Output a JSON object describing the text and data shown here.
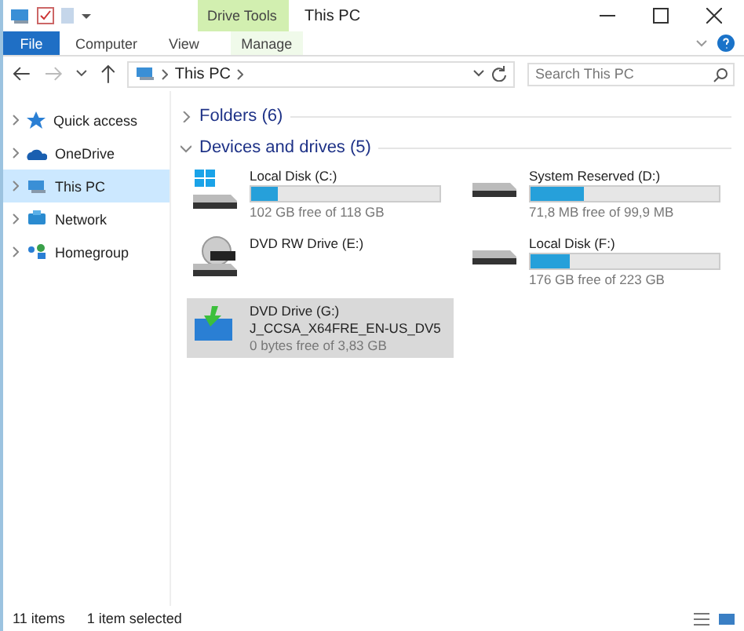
{
  "window": {
    "title": "This PC",
    "context_tab": "Drive Tools"
  },
  "ribbon_tabs": [
    {
      "label": "File",
      "kind": "file"
    },
    {
      "label": "Computer",
      "kind": "plain"
    },
    {
      "label": "View",
      "kind": "plain"
    },
    {
      "label": "Manage",
      "kind": "context"
    }
  ],
  "address": {
    "path": "This PC",
    "search_placeholder": "Search This PC"
  },
  "sidebar": {
    "items": [
      {
        "label": "Quick access",
        "kind": "star",
        "selected": false
      },
      {
        "label": "OneDrive",
        "kind": "cloud",
        "selected": false
      },
      {
        "label": "This PC",
        "kind": "pc",
        "selected": true
      },
      {
        "label": "Network",
        "kind": "network",
        "selected": false
      },
      {
        "label": "Homegroup",
        "kind": "homegroup",
        "selected": false
      }
    ]
  },
  "sections": [
    {
      "title": "Folders (6)",
      "expanded": false
    },
    {
      "title": "Devices and drives (5)",
      "expanded": true
    }
  ],
  "drives": [
    {
      "name": "Local Disk (C:)",
      "kind": "windows-disk",
      "level": 0.14,
      "free": "102 GB free of 118 GB",
      "selected": false
    },
    {
      "name": "System Reserved (D:)",
      "kind": "disk",
      "level": 0.28,
      "free": "71,8 MB free of 99,9 MB",
      "selected": false
    },
    {
      "name": "DVD RW Drive (E:)",
      "kind": "dvd",
      "selected": false
    },
    {
      "name": "Local Disk (F:)",
      "kind": "disk",
      "level": 0.21,
      "free": "176 GB free of 223 GB",
      "selected": false
    },
    {
      "name": "DVD Drive (G:)",
      "kind": "install",
      "label": "J_CCSA_X64FRE_EN-US_DV5",
      "free": "0 bytes free of 3,83 GB",
      "selected": true
    }
  ],
  "status_bar": {
    "count": "11 items",
    "selection": "1 item selected"
  }
}
